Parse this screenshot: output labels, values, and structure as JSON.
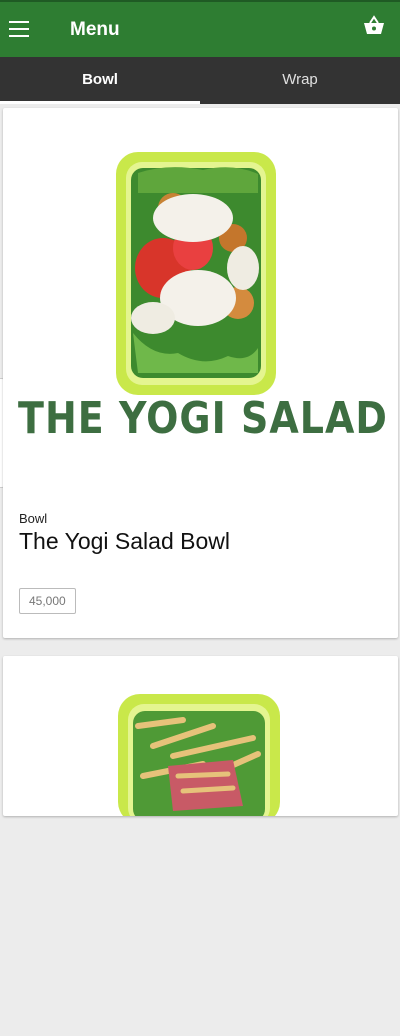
{
  "appbar": {
    "title": "Menu",
    "menu_icon": "hamburger-icon",
    "cart_icon": "basket-icon"
  },
  "tabs": [
    {
      "label": "Bowl",
      "active": true
    },
    {
      "label": "Wrap",
      "active": false
    }
  ],
  "products": [
    {
      "image_text": "THE YOGI SALAD",
      "category": "Bowl",
      "name": "The Yogi Salad Bowl",
      "price": "45,000"
    }
  ],
  "colors": {
    "appbar": "#2e7d32",
    "tabbar": "#333333",
    "logo_text": "#3d6e41"
  }
}
